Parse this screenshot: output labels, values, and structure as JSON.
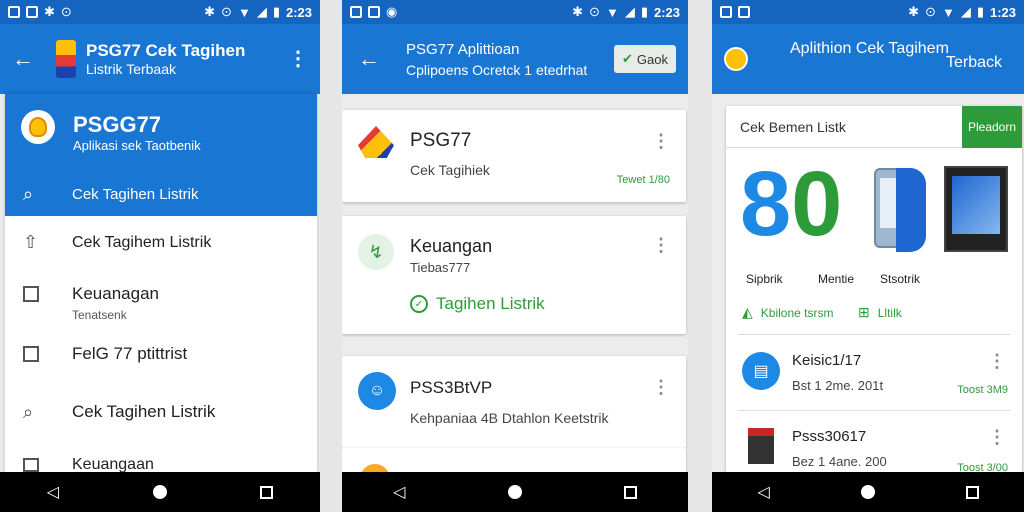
{
  "status_bar": {
    "time_1": "2:23",
    "time_2": "2:23",
    "time_3": "1:23"
  },
  "screen1": {
    "appbar": {
      "title_1": "PSG77 Cek Tagihen",
      "title_2": "Listrik Terbaak"
    },
    "drawer": {
      "header_title": "PSGG77",
      "header_subtitle": "Aplikasi sek Taotbenik",
      "selected_label": "Cek Tagihen Listrik",
      "items": [
        {
          "label": "Cek Tagihem Listrik",
          "sublabel": ""
        },
        {
          "label": "Keuanagan",
          "sublabel": "Tenatsenk"
        },
        {
          "label": "FelG 77 ptittrist",
          "sublabel": ""
        },
        {
          "label": "Cek Tagihen Listrik",
          "sublabel": ""
        },
        {
          "label": "Keuangaan",
          "sublabel": ""
        }
      ]
    }
  },
  "screen2": {
    "appbar": {
      "title_1": "PSG77 Aplittioan",
      "title_2": "Cplipoens Ocretck 1 etedrhat",
      "button_label": "Gaok"
    },
    "cards": [
      {
        "title": "PSG77",
        "subtitle": "Cek Tagihiek",
        "meta": "Tewet 1/80"
      },
      {
        "title": "Keuangan",
        "subtitle": "Tiebas777",
        "action": "Tagihen Listrik"
      },
      {
        "title": "PSS3BtVP",
        "subtitle": "Kehpaniaa 4B Dtahlon Keetstrik"
      },
      {
        "title": ""
      }
    ]
  },
  "screen3": {
    "appbar": {
      "title_1": "Aplithion Cek Tagihem",
      "title_2": "Terback"
    },
    "panel": {
      "header_label": "Cek Bemen Listk",
      "header_button": "Pleadorn",
      "big_number": "80",
      "labels": [
        "Sipbrik",
        "Mentie",
        "Stsotrik"
      ],
      "action_1": "Kbilone tsrsm",
      "action_2": "Lltilk"
    },
    "list": [
      {
        "title": "Keisic1/17",
        "subtitle": "Bst 1 2me. 201t",
        "meta": "Toost 3M9"
      },
      {
        "title": "Psss30617",
        "subtitle": "Bez 1 4ane. 200",
        "meta": "Toost 3/00"
      }
    ]
  },
  "colors": {
    "primary": "#1976d2",
    "status": "#1565c0",
    "green": "#2e9b3a",
    "nav": "#000000"
  },
  "icons": [
    "wifi-icon",
    "battery-icon",
    "bluetooth-icon",
    "alarm-icon",
    "back-icon",
    "home-icon",
    "recents-icon",
    "search-icon",
    "share-icon",
    "bulb-icon"
  ]
}
